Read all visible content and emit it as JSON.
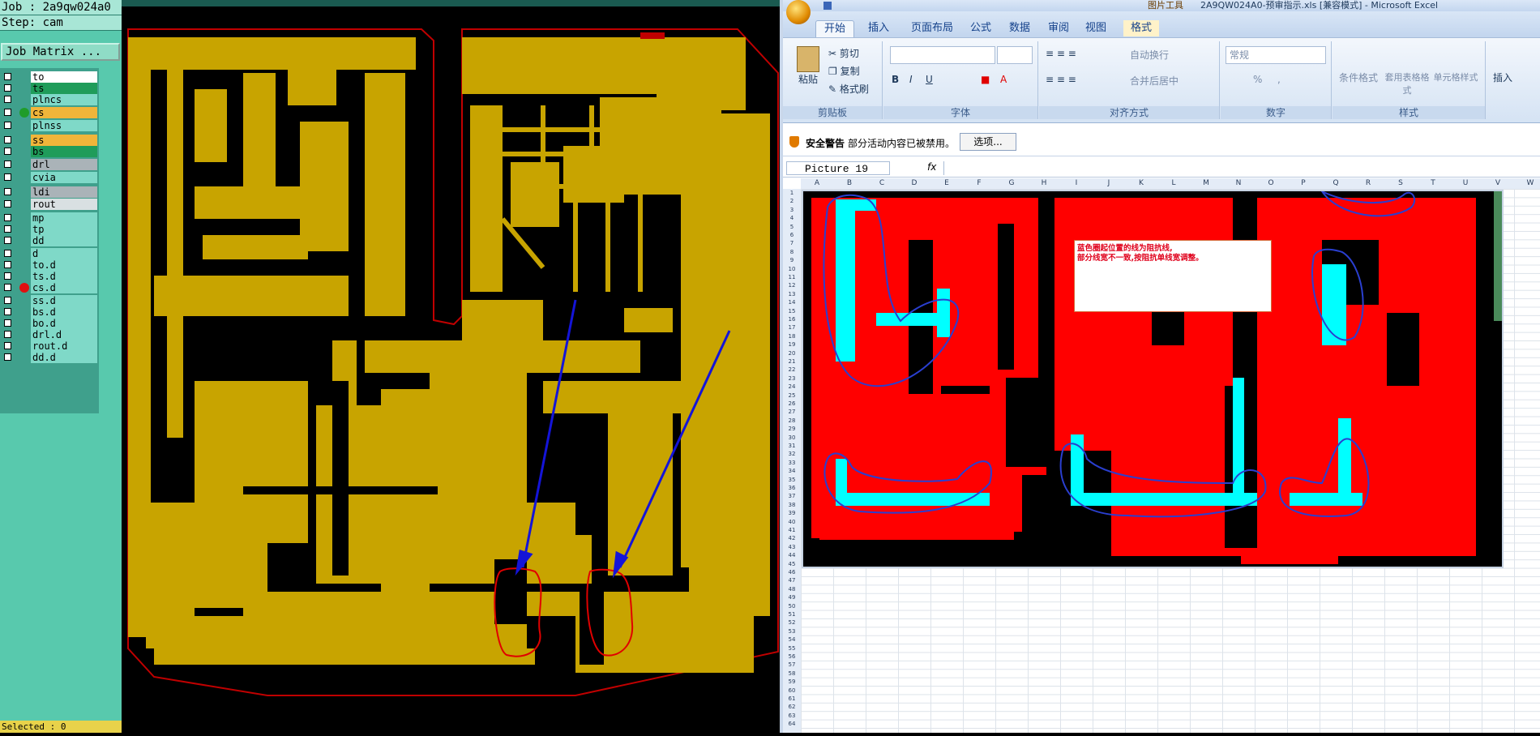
{
  "cam": {
    "job_label": "Job : 2a9qw024a0",
    "step_label": "Step: cam",
    "job_matrix_label": "Job Matrix ...",
    "selected_label": "Selected : 0",
    "layers": [
      {
        "name": "to",
        "color": "#ffffff",
        "dot": ""
      },
      {
        "name": "ts",
        "color": "#1f9c5a",
        "dot": ""
      },
      {
        "name": "plncs",
        "color": "#7fd9c8",
        "dot": ""
      },
      {
        "name": "cs",
        "color": "#f0b53a",
        "dot": "#1f9c2a"
      },
      {
        "name": "plnss",
        "color": "#7fd9c8",
        "dot": ""
      },
      {
        "name": "ss",
        "color": "#f0b53a",
        "dot": ""
      },
      {
        "name": "bs",
        "color": "#1f9c5a",
        "dot": ""
      },
      {
        "name": "drl",
        "color": "#aab3b8",
        "dot": ""
      },
      {
        "name": "cvia",
        "color": "#7fd9c8",
        "dot": ""
      },
      {
        "name": "ldi",
        "color": "#aab3b8",
        "dot": ""
      },
      {
        "name": "rout",
        "color": "#d9e0e2",
        "dot": ""
      },
      {
        "name": "mp",
        "color": "#7fd9c8",
        "dot": ""
      },
      {
        "name": "tp",
        "color": "#7fd9c8",
        "dot": ""
      },
      {
        "name": "dd",
        "color": "#7fd9c8",
        "dot": ""
      },
      {
        "name": "d",
        "color": "#7fd9c8",
        "dot": ""
      },
      {
        "name": "to.d",
        "color": "#7fd9c8",
        "dot": ""
      },
      {
        "name": "ts.d",
        "color": "#7fd9c8",
        "dot": ""
      },
      {
        "name": "cs.d",
        "color": "#7fd9c8",
        "dot": "#e01010"
      },
      {
        "name": "ss.d",
        "color": "#7fd9c8",
        "dot": ""
      },
      {
        "name": "bs.d",
        "color": "#7fd9c8",
        "dot": ""
      },
      {
        "name": "bo.d",
        "color": "#7fd9c8",
        "dot": ""
      },
      {
        "name": "drl.d",
        "color": "#7fd9c8",
        "dot": ""
      },
      {
        "name": "rout.d",
        "color": "#7fd9c8",
        "dot": ""
      },
      {
        "name": "dd.d",
        "color": "#7fd9c8",
        "dot": ""
      }
    ]
  },
  "excel": {
    "title": "2A9QW024A0-预审指示.xls [兼容模式] - Microsoft Excel",
    "contextual_tab": "图片工具",
    "tabs": [
      "开始",
      "插入",
      "页面布局",
      "公式",
      "数据",
      "审阅",
      "视图",
      "格式"
    ],
    "clipboard": {
      "paste": "粘贴",
      "cut": "剪切",
      "copy": "复制",
      "format_painter": "格式刷",
      "group": "剪贴板"
    },
    "font_group": "字体",
    "align_group": {
      "wrap": "自动换行",
      "merge": "合并后居中",
      "group": "对齐方式"
    },
    "number_group": {
      "format": "常规",
      "group": "数字"
    },
    "styles_group": {
      "conditional": "条件格式",
      "table": "套用表格格式",
      "cell": "单元格样式",
      "group": "样式"
    },
    "insert_label": "插入",
    "security": {
      "title": "安全警告",
      "message": "部分活动内容已被禁用。",
      "options": "选项..."
    },
    "name_box": "Picture 19",
    "fx": "fx",
    "columns": [
      "A",
      "B",
      "C",
      "D",
      "E",
      "F",
      "G",
      "H",
      "I",
      "J",
      "K",
      "L",
      "M",
      "N",
      "O",
      "P",
      "Q",
      "R",
      "S",
      "T",
      "U",
      "V",
      "W"
    ],
    "note_lines": [
      "蓝色圈起位置的线为阻抗线,",
      "部分线宽不一致,按阻抗单线宽调整。"
    ],
    "brand_colors": {
      "excel_blue": "#15428b",
      "board_red": "#ff0000",
      "trace_cyan": "#00ffff",
      "cam_copper": "#c8a400"
    }
  }
}
